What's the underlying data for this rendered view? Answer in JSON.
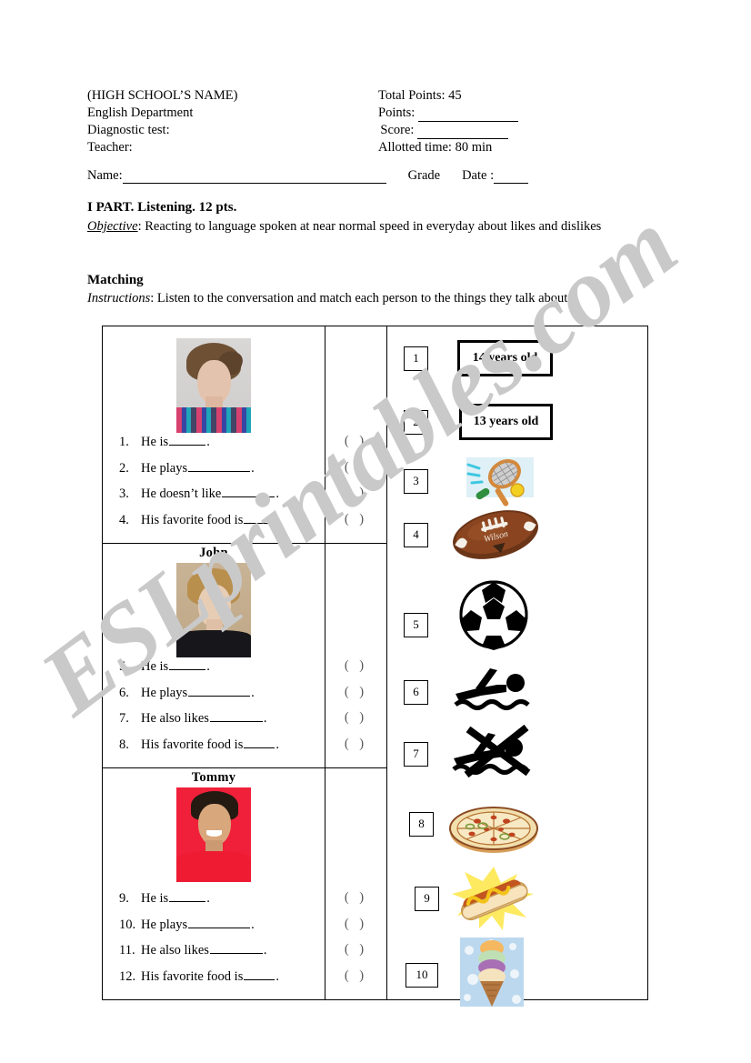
{
  "header": {
    "school": "(HIGH SCHOOL’S NAME)",
    "department": "English Department",
    "test": "Diagnostic test:",
    "teacher": "Teacher:",
    "total_points": "Total Points: 45",
    "points_label": "Points:",
    "score_label": "Score:",
    "allotted_time": "Allotted time: 80 min",
    "name_label": "Name:",
    "grade_label": "Grade",
    "date_label": "Date :"
  },
  "part": {
    "title": "I PART. Listening. 12 pts.",
    "objective_label": "Objective",
    "objective_text": ": Reacting to language spoken at near normal speed in everyday about likes and dislikes",
    "section_title": "Matching",
    "instructions_label": "Instructions",
    "instructions_text": ": Listen to the conversation and match each person to the things they talk about."
  },
  "persons": [
    {
      "name": "",
      "photo": "teen-boy-photo-1",
      "questions": [
        {
          "num": "1.",
          "text": "He is",
          "blank": "b-40",
          "tail": "."
        },
        {
          "num": "2.",
          "text": "He plays",
          "blank": "b-68",
          "tail": "."
        },
        {
          "num": "3.",
          "text": "He doesn’t like",
          "blank": "b-58",
          "tail": "."
        },
        {
          "num": "4.",
          "text": "His favorite food is",
          "blank": "b-34",
          "tail": "."
        }
      ]
    },
    {
      "name": "John",
      "photo": "teen-boy-photo-2",
      "questions": [
        {
          "num": "5.",
          "text": "He is",
          "blank": "b-40",
          "tail": "."
        },
        {
          "num": "6.",
          "text": "He plays",
          "blank": "b-68",
          "tail": "."
        },
        {
          "num": "7.",
          "text": "He also likes",
          "blank": "b-58",
          "tail": "."
        },
        {
          "num": "8.",
          "text": "His favorite food is",
          "blank": "b-34",
          "tail": "."
        }
      ]
    },
    {
      "name": "Tommy",
      "photo": "teen-boy-photo-3",
      "questions": [
        {
          "num": "9.",
          "text": "He is",
          "blank": "b-40",
          "tail": "."
        },
        {
          "num": "10.",
          "text": "He plays",
          "blank": "b-68",
          "tail": "."
        },
        {
          "num": "11.",
          "text": "He also likes",
          "blank": "b-58",
          "tail": "."
        },
        {
          "num": "12.",
          "text": "His favorite food is",
          "blank": "b-34",
          "tail": "."
        }
      ]
    }
  ],
  "answer_marker": "(    )",
  "options": [
    {
      "number": "1",
      "kind": "text",
      "label": "14 years old",
      "icon": ""
    },
    {
      "number": "2",
      "kind": "text",
      "label": "13 years old",
      "icon": ""
    },
    {
      "number": "3",
      "kind": "image",
      "label": "",
      "icon": "tennis-racket-icon"
    },
    {
      "number": "4",
      "kind": "image",
      "label": "",
      "icon": "american-football-icon"
    },
    {
      "number": "5",
      "kind": "image",
      "label": "",
      "icon": "soccer-ball-icon"
    },
    {
      "number": "6",
      "kind": "image",
      "label": "",
      "icon": "swimming-icon"
    },
    {
      "number": "7",
      "kind": "image",
      "label": "",
      "icon": "no-swimming-icon"
    },
    {
      "number": "8",
      "kind": "image",
      "label": "",
      "icon": "pizza-icon"
    },
    {
      "number": "9",
      "kind": "image",
      "label": "",
      "icon": "hot-dog-icon"
    },
    {
      "number": "10",
      "kind": "image",
      "label": "",
      "icon": "ice-cream-cone-icon"
    }
  ],
  "watermark": {
    "text": "ESLprintables.com",
    "color": "#c9c9c9"
  }
}
